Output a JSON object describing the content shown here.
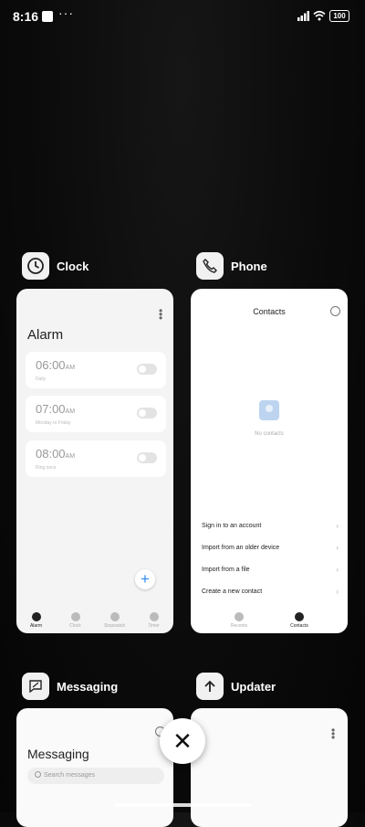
{
  "status_bar": {
    "time": "8:16",
    "dots": "···",
    "battery": "100"
  },
  "apps": {
    "clock": {
      "name": "Clock",
      "screen_title": "Alarm",
      "alarms": [
        {
          "time": "06:00",
          "ampm": "AM",
          "sub": "Daily"
        },
        {
          "time": "07:00",
          "ampm": "AM",
          "sub": "Monday to Friday"
        },
        {
          "time": "08:00",
          "ampm": "AM",
          "sub": "Ring once"
        }
      ],
      "fab": "+",
      "nav": [
        "Alarm",
        "Clock",
        "Stopwatch",
        "Timer"
      ]
    },
    "phone": {
      "name": "Phone",
      "screen_title": "Contacts",
      "empty": "No contacts",
      "rows": [
        "Sign in to an account",
        "Import from an older device",
        "Import from a file",
        "Create a new contact"
      ],
      "chevron": "›",
      "nav": [
        "Recents",
        "Contacts"
      ]
    },
    "messaging": {
      "name": "Messaging",
      "screen_title": "Messaging",
      "search_placeholder": "Search messages"
    },
    "updater": {
      "name": "Updater"
    }
  },
  "close_label": "✕",
  "colors": {
    "accent": "#2d8cf0",
    "background": "#0b0b0b",
    "card": "#f4f4f4"
  }
}
